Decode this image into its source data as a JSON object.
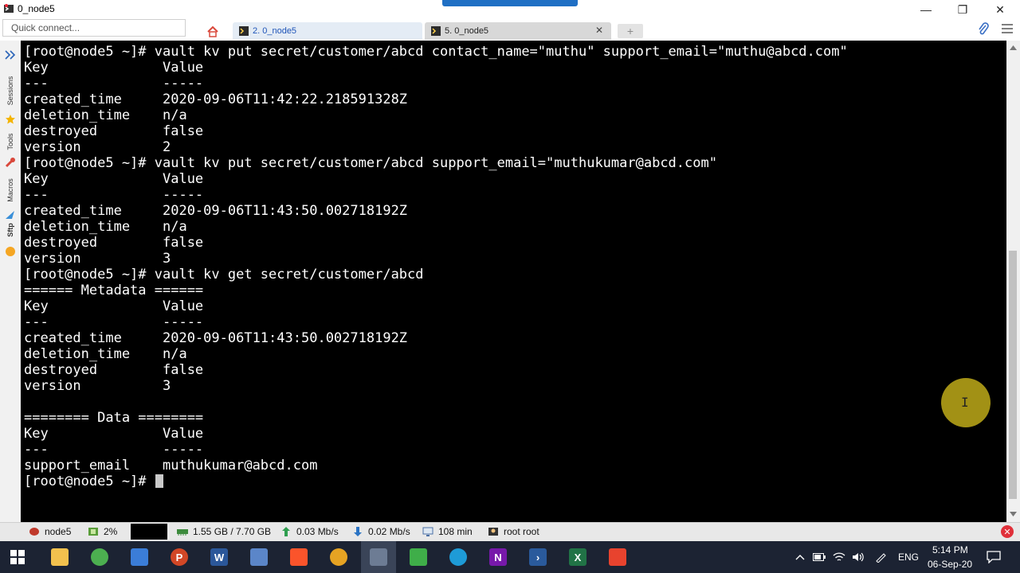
{
  "window": {
    "title": "0_node5",
    "controls": {
      "minimize": "—",
      "maximize": "❐",
      "close": "✕"
    }
  },
  "toolbar": {
    "quick_connect_placeholder": "Quick connect...",
    "tabs": [
      {
        "label": "2. 0_node5",
        "active": false
      },
      {
        "label": "5. 0_node5",
        "active": true
      }
    ],
    "tab_close": "✕",
    "new_tab": "+"
  },
  "side_dock": {
    "items": [
      "Sessions",
      "Tools",
      "Macros",
      "Sftp"
    ]
  },
  "terminal": {
    "lines": [
      "[root@node5 ~]# vault kv put secret/customer/abcd contact_name=\"muthu\" support_email=\"muthu@abcd.com\"",
      "Key              Value",
      "---              -----",
      "created_time     2020-09-06T11:42:22.218591328Z",
      "deletion_time    n/a",
      "destroyed        false",
      "version          2",
      "[root@node5 ~]# vault kv put secret/customer/abcd support_email=\"muthukumar@abcd.com\"",
      "Key              Value",
      "---              -----",
      "created_time     2020-09-06T11:43:50.002718192Z",
      "deletion_time    n/a",
      "destroyed        false",
      "version          3",
      "[root@node5 ~]# vault kv get secret/customer/abcd",
      "====== Metadata ======",
      "Key              Value",
      "---              -----",
      "created_time     2020-09-06T11:43:50.002718192Z",
      "deletion_time    n/a",
      "destroyed        false",
      "version          3",
      "",
      "======== Data ========",
      "Key              Value",
      "---              -----",
      "support_email    muthukumar@abcd.com"
    ],
    "prompt": "[root@node5 ~]# "
  },
  "status_bar": {
    "host": "node5",
    "cpu": "2%",
    "memory": "1.55 GB / 7.70 GB",
    "upload": "0.03 Mb/s",
    "download": "0.02 Mb/s",
    "uptime": "108 min",
    "users": "root  root",
    "close": "✕"
  },
  "taskbar": {
    "clock_time": "5:14 PM",
    "clock_date": "06-Sep-20",
    "language": "ENG",
    "apps": [
      {
        "name": "file-explorer",
        "color": "#f2c14e",
        "glyph": ""
      },
      {
        "name": "chrome",
        "color": "#4caf50",
        "glyph": ""
      },
      {
        "name": "remote-desktop",
        "color": "#3b7dd8",
        "glyph": ""
      },
      {
        "name": "powerpoint",
        "color": "#d24726",
        "glyph": "P"
      },
      {
        "name": "word",
        "color": "#2b579a",
        "glyph": "W"
      },
      {
        "name": "network-tool",
        "color": "#5b86c9",
        "glyph": ""
      },
      {
        "name": "brave",
        "color": "#fb542b",
        "glyph": ""
      },
      {
        "name": "media-app",
        "color": "#e6a323",
        "glyph": ""
      },
      {
        "name": "mobaxterm",
        "color": "#6d7c94",
        "glyph": ""
      },
      {
        "name": "camtasia",
        "color": "#3fae49",
        "glyph": ""
      },
      {
        "name": "edge",
        "color": "#1e9bd7",
        "glyph": ""
      },
      {
        "name": "onenote",
        "color": "#7719aa",
        "glyph": "N"
      },
      {
        "name": "powershell",
        "color": "#2a5a9c",
        "glyph": "›"
      },
      {
        "name": "excel",
        "color": "#217346",
        "glyph": "X"
      },
      {
        "name": "camtasia-recorder",
        "color": "#e8432e",
        "glyph": ""
      }
    ]
  }
}
